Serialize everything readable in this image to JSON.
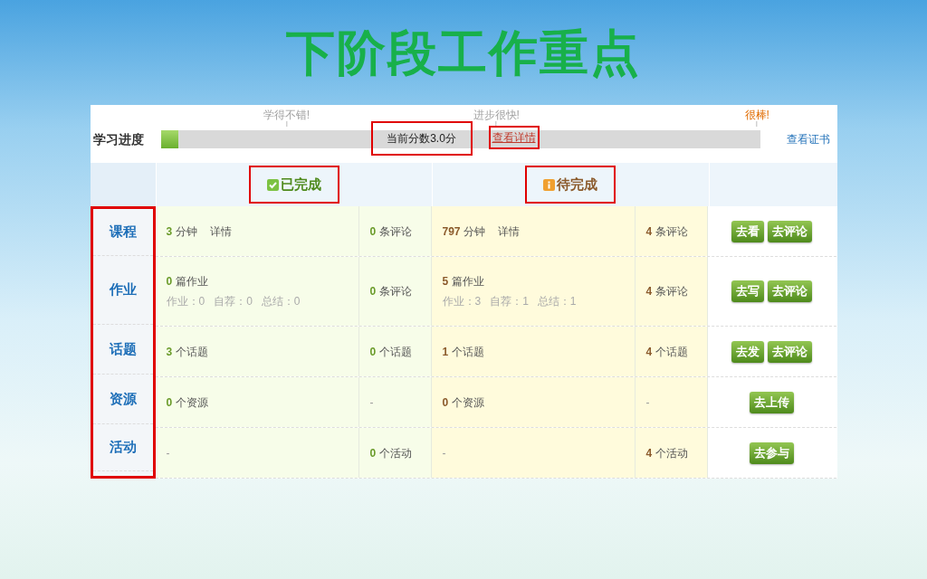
{
  "title": "下阶段工作重点",
  "progress": {
    "label": "学习进度",
    "level": 0.03,
    "milestones": [
      {
        "label": "学得不错!",
        "color": "#a0a0a0"
      },
      {
        "label": "进步很快!",
        "color": "#a0a0a0"
      },
      {
        "label": "很棒!",
        "color": "#e06c00"
      }
    ],
    "score": {
      "text": "当前分数3.0分",
      "highlighted": true
    },
    "detail_link": {
      "text": "查看详情",
      "highlighted": true
    },
    "certificate_link": "查看证书"
  },
  "groups": [
    {
      "label": "已完成",
      "kind": "check",
      "highlighted": true
    },
    {
      "label": "待完成",
      "kind": "info",
      "highlighted": true
    }
  ],
  "categories_highlighted": true,
  "rows": [
    {
      "category": "课程",
      "done": [
        {
          "number": "3",
          "text": "分钟",
          "extra": "详情"
        },
        {
          "number": "0",
          "text": "条评论"
        }
      ],
      "pending": [
        {
          "number": "797",
          "text": "分钟",
          "extra": "详情"
        },
        {
          "number": "4",
          "text": "条评论"
        }
      ],
      "buttons": [
        "去看",
        "去评论"
      ]
    },
    {
      "category": "作业",
      "done": [
        {
          "number": "0",
          "text": "篇作业",
          "sub": "作业：0   自荐：0   总结：0"
        },
        {
          "number": "0",
          "text": "条评论"
        }
      ],
      "pending": [
        {
          "number": "5",
          "text": "篇作业",
          "sub": "作业：3   自荐：1   总结：1"
        },
        {
          "number": "4",
          "text": "条评论"
        }
      ],
      "buttons": [
        "去写",
        "去评论"
      ]
    },
    {
      "category": "话题",
      "done": [
        {
          "number": "3",
          "text": "个话题"
        },
        {
          "number": "0",
          "text": "个话题"
        }
      ],
      "pending": [
        {
          "number": "1",
          "text": "个话题"
        },
        {
          "number": "4",
          "text": "个话题"
        }
      ],
      "buttons": [
        "去发",
        "去评论"
      ]
    },
    {
      "category": "资源",
      "done": [
        {
          "number": "0",
          "text": "个资源"
        },
        {
          "text": "-"
        }
      ],
      "pending": [
        {
          "number": "0",
          "text": "个资源"
        },
        {
          "text": "-"
        }
      ],
      "buttons": [
        "去上传"
      ]
    },
    {
      "category": "活动",
      "done": [
        {
          "text": "-"
        },
        {
          "number": "0",
          "text": "个活动"
        }
      ],
      "pending": [
        {
          "text": "-"
        },
        {
          "number": "4",
          "text": "个活动"
        }
      ],
      "buttons": [
        "去参与"
      ]
    }
  ]
}
